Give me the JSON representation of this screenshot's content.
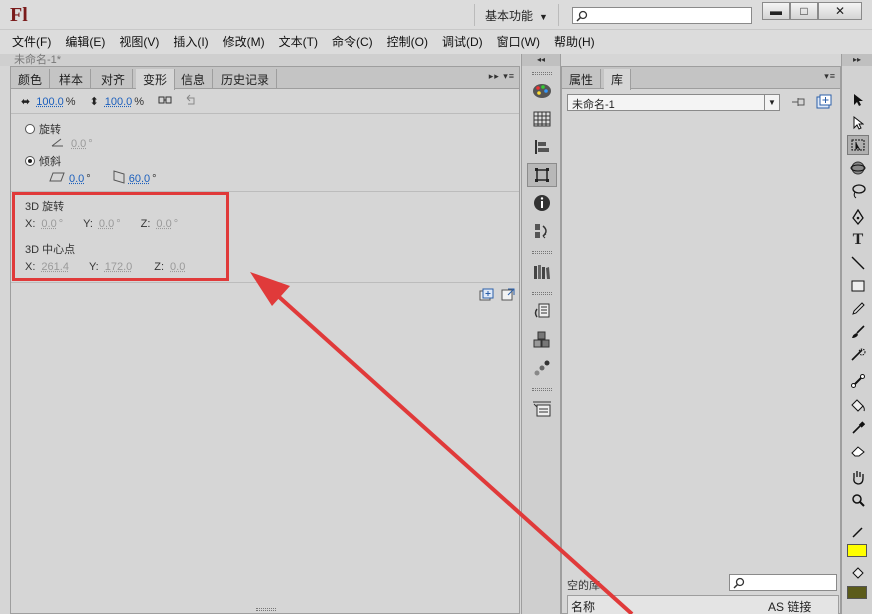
{
  "app": {
    "logo": "Fl",
    "workspace": "基本功能"
  },
  "menu": [
    "文件(F)",
    "编辑(E)",
    "视图(V)",
    "插入(I)",
    "修改(M)",
    "文本(T)",
    "命令(C)",
    "控制(O)",
    "调试(D)",
    "窗口(W)",
    "帮助(H)"
  ],
  "doc_tab": "未命名-1*",
  "left_tabs": [
    "颜色",
    "样本",
    "对齐",
    "变形",
    "信息",
    "历史记录"
  ],
  "transform": {
    "scale_width": "100.0",
    "scale_height": "100.0",
    "percent": "%",
    "rotate_label": "旋转",
    "rotate_value": "0.0",
    "skew_label": "倾斜",
    "skew_h": "0.0",
    "skew_v": "60.0",
    "degree": "°",
    "rot3d_label": "3D 旋转",
    "rot3d_x": "0.0",
    "rot3d_y": "0.0",
    "rot3d_z": "0.0",
    "center3d_label": "3D 中心点",
    "center_x": "261.4",
    "center_y": "172.0",
    "center_z": "0.0",
    "x_label": "X:",
    "y_label": "Y:",
    "z_label": "Z:"
  },
  "library": {
    "tabs": [
      "属性",
      "库"
    ],
    "document": "未命名-1",
    "empty_label": "空的库",
    "col_name": "名称",
    "col_linkage": "AS 链接"
  },
  "colors": {
    "stroke": "#3a3a3a",
    "fill": "#ffff00",
    "annotation": "#e03a3a"
  }
}
